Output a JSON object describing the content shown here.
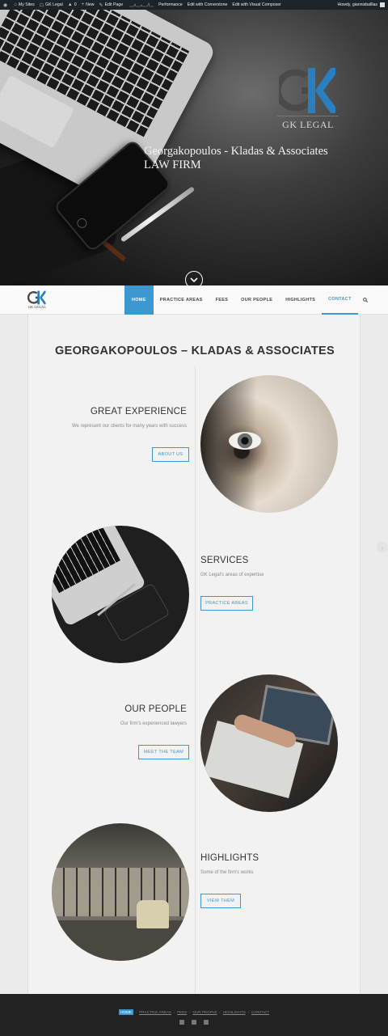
{
  "admin_bar": {
    "my_sites": "My Sites",
    "site_name": "GK Legal",
    "comments_count": "0",
    "new_label": "New",
    "edit_page": "Edit Page",
    "performance": "Performance",
    "edit_cornerstone": "Edit with Cornerstone",
    "edit_visual_composer": "Edit with Visual Composer",
    "greeting": "Howdy, giannisballlas"
  },
  "hero": {
    "logo_text": "GK LEGAL",
    "title_line1": "Georgakopoulos - Kladas & Associates",
    "title_line2": "LAW FIRM",
    "scroll_icon": "chevron-down-circle"
  },
  "nav": {
    "logo_text": "GK LEGAL",
    "items": [
      {
        "label": "HOME"
      },
      {
        "label": "PRACTICE AREAS"
      },
      {
        "label": "FEES"
      },
      {
        "label": "OUR PEOPLE"
      },
      {
        "label": "HIGHLIGHTS"
      },
      {
        "label": "CONTACT"
      }
    ],
    "search_icon": "search-icon"
  },
  "page": {
    "title": "GEORGAKOPOULOS – KLADAS & ASSOCIATES"
  },
  "sections": [
    {
      "title": "GREAT EXPERIENCE",
      "desc": "We represent our clients for many years with success",
      "button": "ABOUT US"
    },
    {
      "title": "SERVICES",
      "desc": "GK Legal's areas of expertise",
      "button": "PRACTICE AREAS"
    },
    {
      "title": "OUR PEOPLE",
      "desc": "Our firm's experienced lawyers",
      "button": "MEET THE TEAM"
    },
    {
      "title": "HIGHLIGHTS",
      "desc": "Some of the firm's works",
      "button": "VIEW THEM"
    }
  ],
  "footer": {
    "items": [
      "HOME",
      "PRACTICE AREAS",
      "FEES",
      "OUR PEOPLE",
      "HIGHLIGHTS",
      "CONTACT"
    ]
  },
  "colors": {
    "accent": "#3d97d0",
    "footer_bg": "#222222",
    "content_bg": "#f2f2f2"
  }
}
